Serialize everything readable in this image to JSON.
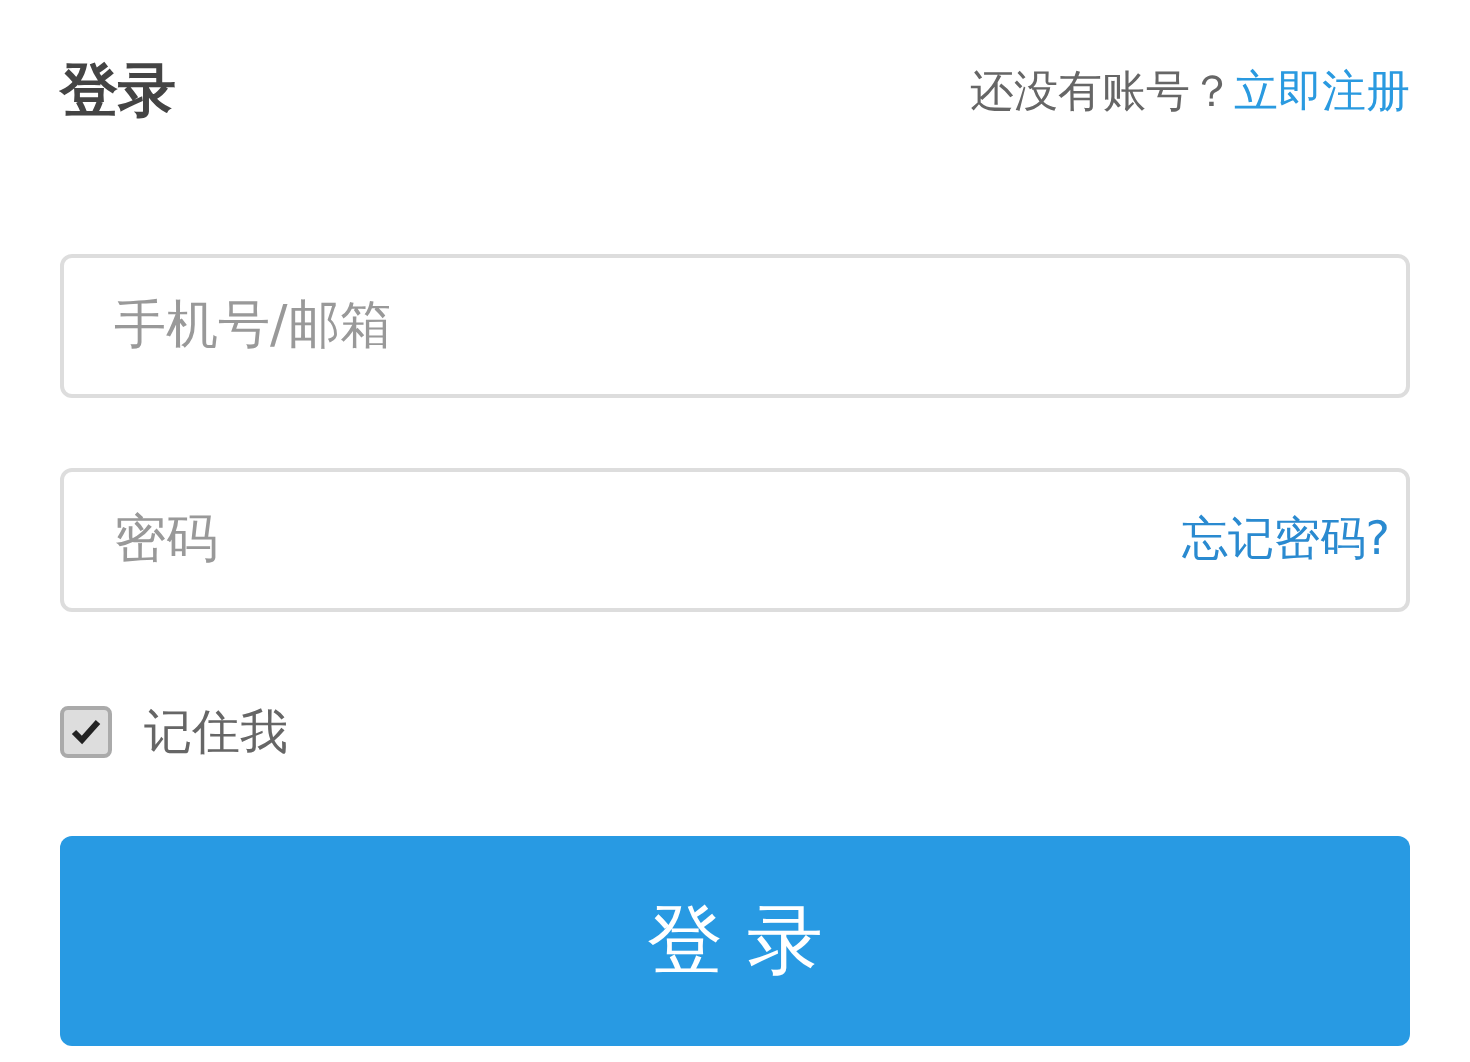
{
  "title": "登录",
  "signup": {
    "prompt": "还没有账号？",
    "link": "立即注册"
  },
  "account_field": {
    "placeholder": "手机号/邮箱"
  },
  "password_field": {
    "placeholder": "密码",
    "forgot_link": "忘记密码?"
  },
  "remember": {
    "label": "记住我",
    "checked": true
  },
  "submit_button": "登 录"
}
